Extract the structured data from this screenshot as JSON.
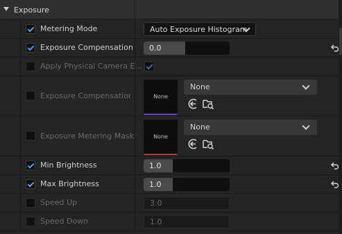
{
  "category": {
    "title": "Exposure"
  },
  "properties": {
    "metering_mode": {
      "label": "Metering Mode",
      "enabled": true,
      "value": "Auto Exposure Histogram"
    },
    "exposure_compensation": {
      "label": "Exposure Compensation",
      "enabled": true,
      "value": "0.0"
    },
    "apply_physical_camera": {
      "label": "Apply Physical Camera E...",
      "enabled": false,
      "value_checked": true
    },
    "exposure_compensation_curve": {
      "label": "Exposure Compensation...",
      "enabled": false,
      "thumbnail_text": "None",
      "asset": "None"
    },
    "exposure_metering_mask": {
      "label": "Exposure Metering Mask",
      "enabled": false,
      "thumbnail_text": "None",
      "asset": "None"
    },
    "min_brightness": {
      "label": "Min Brightness",
      "enabled": true,
      "value": "1.0"
    },
    "max_brightness": {
      "label": "Max Brightness",
      "enabled": true,
      "value": "1.0"
    },
    "speed_up": {
      "label": "Speed Up",
      "enabled": false,
      "value": "3.0"
    },
    "speed_down": {
      "label": "Speed Down",
      "enabled": false,
      "value": "1.0"
    }
  },
  "colors": {
    "accent_check": "#4b9cf0",
    "curve_thumb_bar": "#6a3fbf",
    "mask_thumb_bar": "#b03a3a"
  }
}
